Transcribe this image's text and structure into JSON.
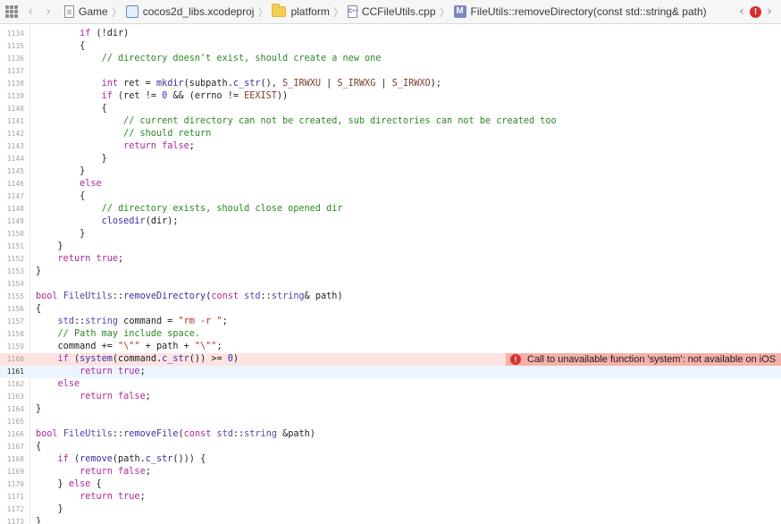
{
  "jumpbar": {
    "crumbs": [
      "Game",
      "cocos2d_libs.xcodeproj",
      "platform",
      "CCFileUtils.cpp",
      "FileUtils::removeDirectory(const std::string& path)"
    ],
    "method_badge": "M",
    "cpp_badge": "C++",
    "error_badge": "!"
  },
  "error": {
    "message": "Call to unavailable function 'system': not available on iOS",
    "badge": "!"
  },
  "colors": {
    "keyword": "#b0279a",
    "comment": "#2a8a1f",
    "number": "#2f32d6",
    "string": "#c4281b",
    "error_line": "#fde4e2",
    "error_banner": "#f6b0aa",
    "current_line": "#ecf5ff"
  },
  "lines": [
    {
      "n": "1134",
      "t": "        if (!dir)"
    },
    {
      "n": "1135",
      "t": "        {"
    },
    {
      "n": "1136",
      "t": "            // directory doesn't exist, should create a new one"
    },
    {
      "n": "1137",
      "t": ""
    },
    {
      "n": "1138",
      "t": "            int ret = mkdir(subpath.c_str(), S_IRWXU | S_IRWXG | S_IRWXO);"
    },
    {
      "n": "1139",
      "t": "            if (ret != 0 && (errno != EEXIST))"
    },
    {
      "n": "1140",
      "t": "            {"
    },
    {
      "n": "1141",
      "t": "                // current directory can not be created, sub directories can not be created too"
    },
    {
      "n": "1142",
      "t": "                // should return"
    },
    {
      "n": "1143",
      "t": "                return false;"
    },
    {
      "n": "1144",
      "t": "            }"
    },
    {
      "n": "1145",
      "t": "        }"
    },
    {
      "n": "1146",
      "t": "        else"
    },
    {
      "n": "1147",
      "t": "        {"
    },
    {
      "n": "1148",
      "t": "            // directory exists, should close opened dir"
    },
    {
      "n": "1149",
      "t": "            closedir(dir);"
    },
    {
      "n": "1150",
      "t": "        }"
    },
    {
      "n": "1151",
      "t": "    }"
    },
    {
      "n": "1152",
      "t": "    return true;"
    },
    {
      "n": "1153",
      "t": "}"
    },
    {
      "n": "1154",
      "t": ""
    },
    {
      "n": "1155",
      "t": "bool FileUtils::removeDirectory(const std::string& path)"
    },
    {
      "n": "1156",
      "t": "{"
    },
    {
      "n": "1157",
      "t": "    std::string command = \"rm -r \";"
    },
    {
      "n": "1158",
      "t": "    // Path may include space."
    },
    {
      "n": "1159",
      "t": "    command += \"\\\"\" + path + \"\\\"\";"
    },
    {
      "n": "1160",
      "t": "    if (system(command.c_str()) >= 0)"
    },
    {
      "n": "1161",
      "t": "        return true;"
    },
    {
      "n": "1162",
      "t": "    else"
    },
    {
      "n": "1163",
      "t": "        return false;"
    },
    {
      "n": "1164",
      "t": "}"
    },
    {
      "n": "1165",
      "t": ""
    },
    {
      "n": "1166",
      "t": "bool FileUtils::removeFile(const std::string &path)"
    },
    {
      "n": "1167",
      "t": "{"
    },
    {
      "n": "1168",
      "t": "    if (remove(path.c_str())) {"
    },
    {
      "n": "1169",
      "t": "        return false;"
    },
    {
      "n": "1170",
      "t": "    } else {"
    },
    {
      "n": "1171",
      "t": "        return true;"
    },
    {
      "n": "1172",
      "t": "    }"
    },
    {
      "n": "1173",
      "t": "}"
    }
  ],
  "error_line_number": "1160",
  "current_line_number": "1161"
}
